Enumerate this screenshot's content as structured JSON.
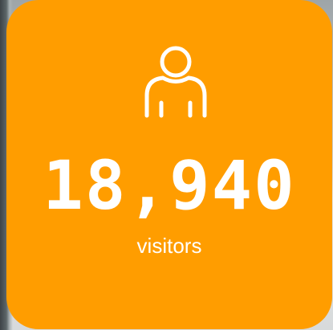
{
  "stat_card": {
    "icon": "person-icon",
    "value": "18,940",
    "label": "visitors",
    "background_color": "#ff9d00",
    "text_color": "#ffffff"
  }
}
